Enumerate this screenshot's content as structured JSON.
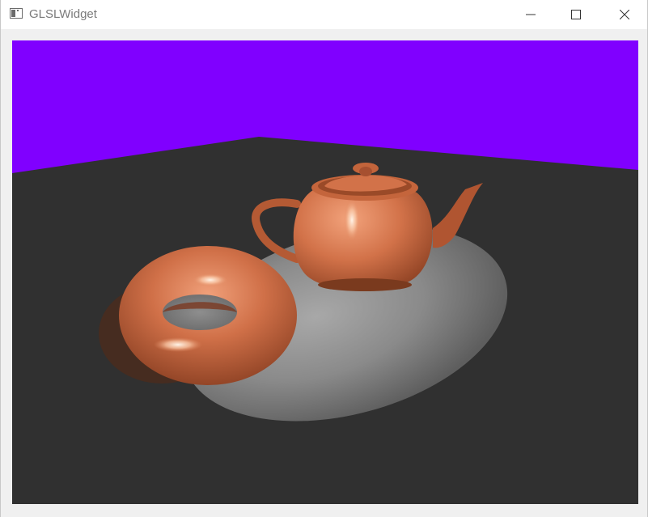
{
  "window": {
    "title": "GLSLWidget"
  },
  "icons": {
    "app": "app-window-icon",
    "minimize": "minimize-icon",
    "maximize": "maximize-icon",
    "close": "close-icon"
  },
  "colors": {
    "background_wall": "#8000ff",
    "floor": "#303030",
    "material": "#d9774a"
  }
}
